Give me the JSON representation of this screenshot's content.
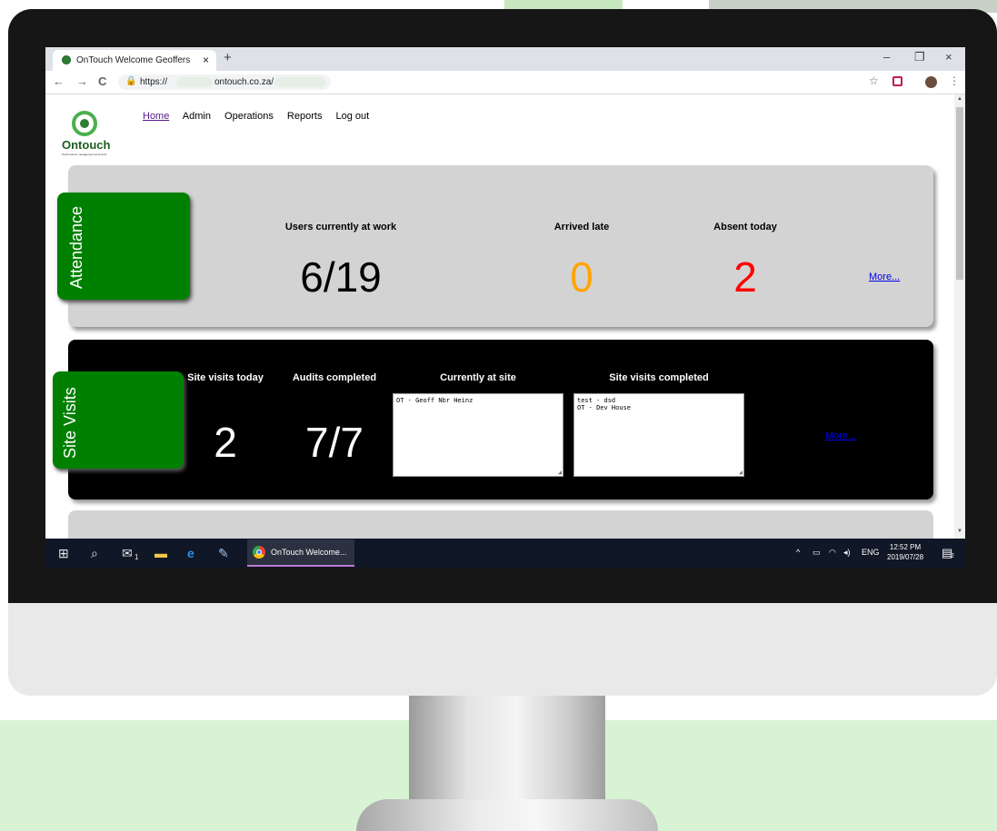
{
  "browser": {
    "tab_title": "OnTouch Welcome Geoffers",
    "tab_close": "×",
    "new_tab": "+",
    "minimize": "–",
    "restore": "❐",
    "close": "×",
    "url_prefix": "https://",
    "url_domain": "ontouch.co.za/",
    "back": "←",
    "forward": "→",
    "reload": "C",
    "lock": "🔒",
    "star": "☆",
    "menu": "⋮"
  },
  "site": {
    "logo_text": "Ontouch",
    "logo_tagline": "Performance management at its best",
    "nav": [
      {
        "label": "Home",
        "active": true
      },
      {
        "label": "Admin"
      },
      {
        "label": "Operations"
      },
      {
        "label": "Reports"
      },
      {
        "label": "Log out"
      }
    ]
  },
  "attendance": {
    "section_label": "Attendance",
    "stats": [
      {
        "label": "Users currently at work",
        "value": "6/19",
        "color": "#000000"
      },
      {
        "label": "Arrived late",
        "value": "0",
        "color": "#FFA500"
      },
      {
        "label": "Absent today",
        "value": "2",
        "color": "#FF0000"
      }
    ],
    "more": "More..."
  },
  "site_visits": {
    "section_label": "Site Visits",
    "stats": [
      {
        "label": "Site visits today",
        "value": "2"
      },
      {
        "label": "Audits completed",
        "value": "7/7"
      }
    ],
    "currently_at_site_label": "Currently at site",
    "currently_at_site": [
      "OT - Geoff Nbr Heinz"
    ],
    "completed_label": "Site visits completed",
    "completed": [
      "test - dsd",
      "OT - Dev House"
    ],
    "more": "More..."
  },
  "taskbar": {
    "app_label": "OnTouch Welcome...",
    "language": "ENG",
    "time": "12:52 PM",
    "date": "2019/07/28",
    "notifications": "2",
    "mail_badge": "1"
  },
  "colors": {
    "side_label_bg": "#008000",
    "attendance_bg": "#D3D3D3",
    "visits_bg": "#000000",
    "link": "#0000EE",
    "taskbar": "#101726"
  }
}
